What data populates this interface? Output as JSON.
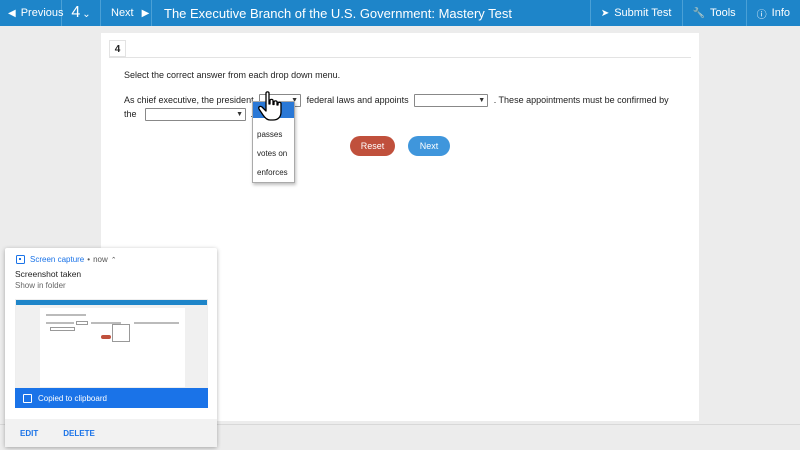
{
  "topbar": {
    "previous_label": "Previous",
    "question_number": "4",
    "next_label": "Next",
    "title": "The Executive Branch of the U.S. Government: Mastery Test",
    "submit_label": "Submit Test",
    "tools_label": "Tools",
    "info_label": "Info"
  },
  "question": {
    "number": "4",
    "instruction": "Select the correct answer from each drop down menu.",
    "part1": "As chief executive, the president",
    "part2": "federal laws and appoints",
    "part3": ". These appointments must be confirmed by",
    "part4": "the",
    "part5": ".",
    "dropdown_options": [
      "passes",
      "votes on",
      "enforces"
    ]
  },
  "buttons": {
    "reset_label": "Reset",
    "next_label": "Next"
  },
  "notification": {
    "app": "Screen capture",
    "separator": "•",
    "time": "now",
    "title": "Screenshot taken",
    "subtitle": "Show in folder",
    "clipboard": "Copied to clipboard",
    "edit_label": "EDIT",
    "delete_label": "DELETE"
  },
  "colors": {
    "topbar": "#1e85c9",
    "reset": "#c0503c",
    "next": "#3f96dc",
    "notification_accent": "#1a73e8"
  }
}
